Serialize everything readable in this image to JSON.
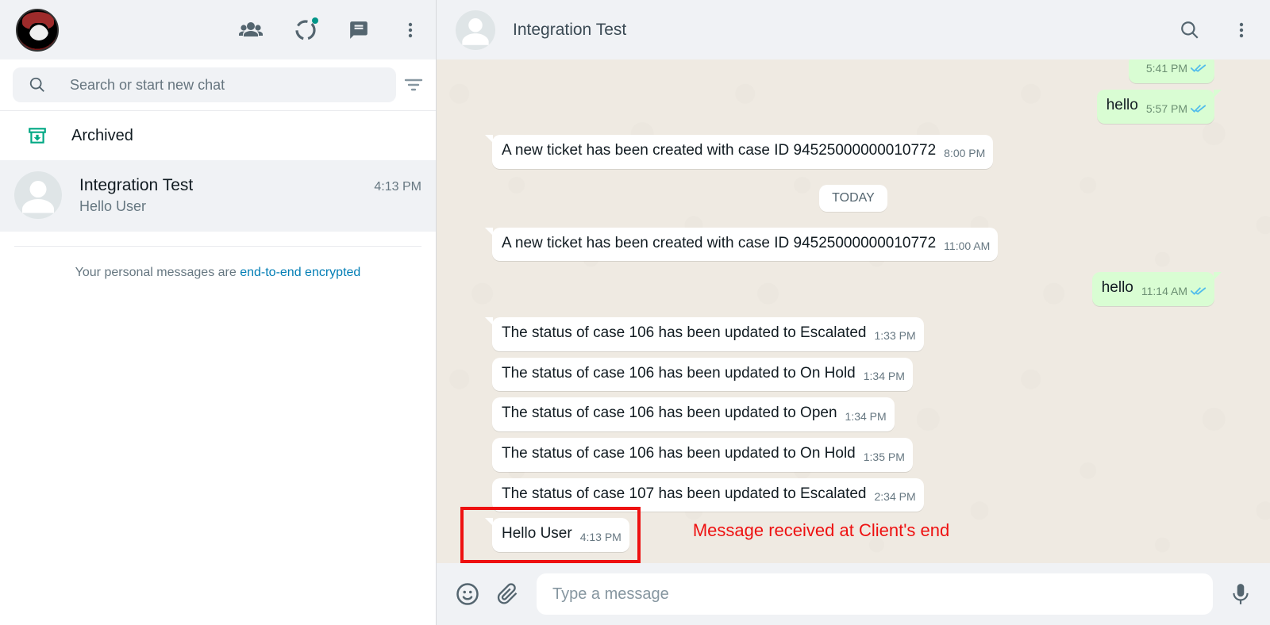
{
  "sidebar": {
    "search_placeholder": "Search or start new chat",
    "archived_label": "Archived",
    "e2e_pre": "Your personal messages are ",
    "e2e_link": "end-to-end encrypted",
    "chats": [
      {
        "name": "Integration Test",
        "last": "Hello User",
        "time": "4:13 PM",
        "selected": true
      }
    ]
  },
  "chat": {
    "title": "Integration Test",
    "composer_placeholder": "Type a message",
    "day_label": "TODAY",
    "messages_pre": [
      {
        "dir": "out",
        "text": "",
        "time": "5:41 PM",
        "tail": false,
        "checks": true
      },
      {
        "dir": "out",
        "text": "hello",
        "time": "5:57 PM",
        "tail": true,
        "checks": true
      },
      {
        "dir": "in",
        "text": "A new ticket has been created with case ID 94525000000010772",
        "time": "8:00 PM",
        "tail": true
      }
    ],
    "messages_today": [
      {
        "dir": "in",
        "text": "A new ticket has been created with case ID 94525000000010772",
        "time": "11:00 AM",
        "tail": true
      },
      {
        "dir": "out",
        "text": "hello",
        "time": "11:14 AM",
        "tail": true,
        "checks": true
      },
      {
        "dir": "in",
        "text": "The status of case 106 has been updated to Escalated",
        "time": "1:33 PM",
        "tail": true
      },
      {
        "dir": "in",
        "text": "The status of case 106 has been updated to On Hold",
        "time": "1:34 PM",
        "tail": false
      },
      {
        "dir": "in",
        "text": "The status of case 106 has been updated to Open",
        "time": "1:34 PM",
        "tail": false
      },
      {
        "dir": "in",
        "text": "The status of case 106 has been updated to On Hold",
        "time": "1:35 PM",
        "tail": false
      },
      {
        "dir": "in",
        "text": "The status of case 107 has been updated to Escalated",
        "time": "2:34 PM",
        "tail": false
      },
      {
        "dir": "in",
        "text": "Hello User",
        "time": "4:13 PM",
        "tail": true,
        "highlight": true
      }
    ],
    "annotation_text": "Message received at Client's end"
  }
}
